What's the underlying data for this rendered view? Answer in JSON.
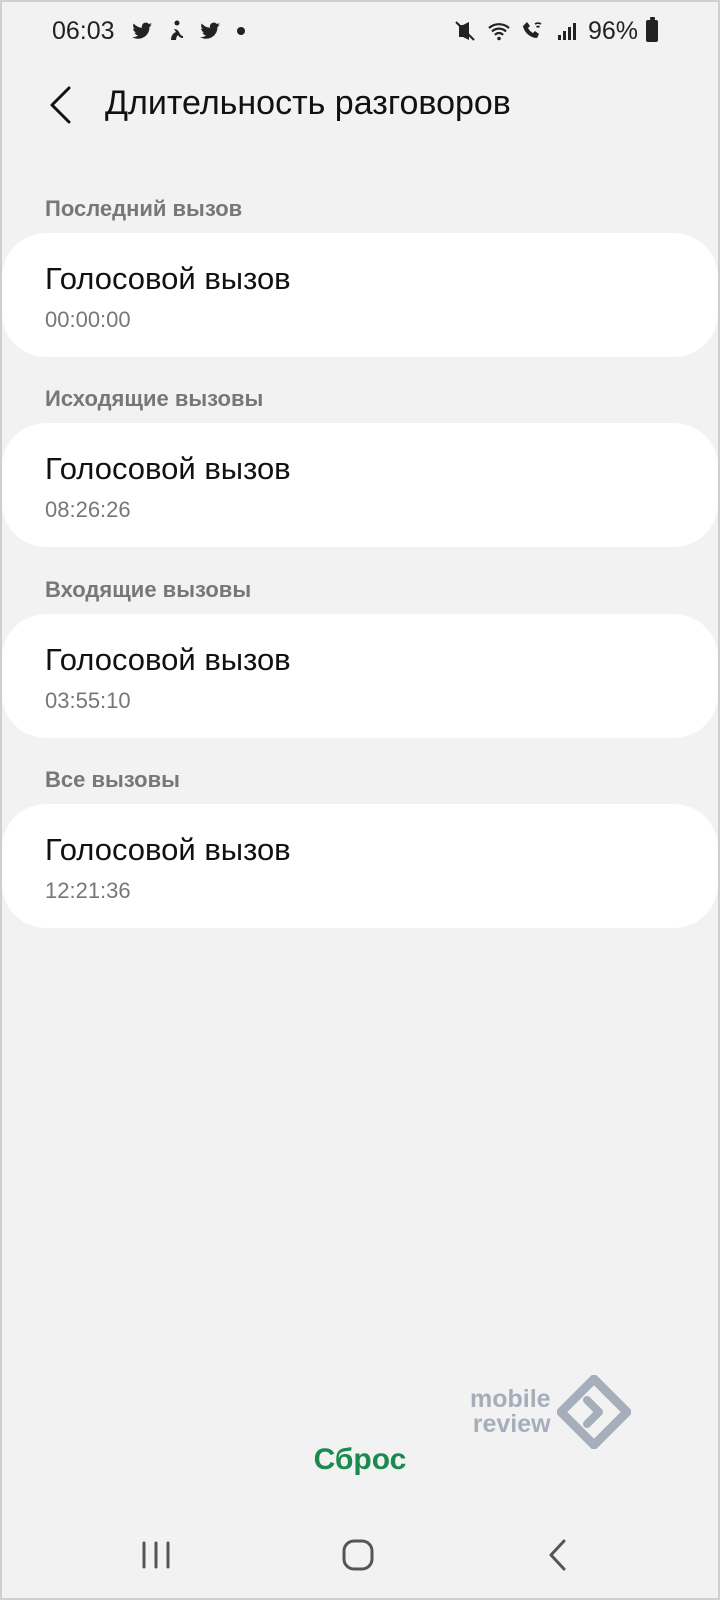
{
  "status_bar": {
    "time": "06:03",
    "battery": "96%",
    "left_icons": [
      "twitter-icon",
      "accessibility-icon",
      "twitter-icon",
      "dot-icon"
    ],
    "right_icons": [
      "mute-vibrate-icon",
      "wifi-icon",
      "wifi-call-icon",
      "signal-icon",
      "battery-icon"
    ]
  },
  "header": {
    "title": "Длительность разговоров"
  },
  "sections": [
    {
      "label": "Последний вызов",
      "item_title": "Голосовой вызов",
      "item_value": "00:00:00"
    },
    {
      "label": "Исходящие вызовы",
      "item_title": "Голосовой вызов",
      "item_value": "08:26:26"
    },
    {
      "label": "Входящие вызовы",
      "item_title": "Голосовой вызов",
      "item_value": "03:55:10"
    },
    {
      "label": "Все вызовы",
      "item_title": "Голосовой вызов",
      "item_value": "12:21:36"
    }
  ],
  "watermark": {
    "line1": "mobile",
    "line2": "review"
  },
  "reset_label": "Сброс",
  "colors": {
    "accent": "#1a8a4e",
    "background": "#f2f2f2",
    "card": "#ffffff",
    "muted": "#777777"
  }
}
